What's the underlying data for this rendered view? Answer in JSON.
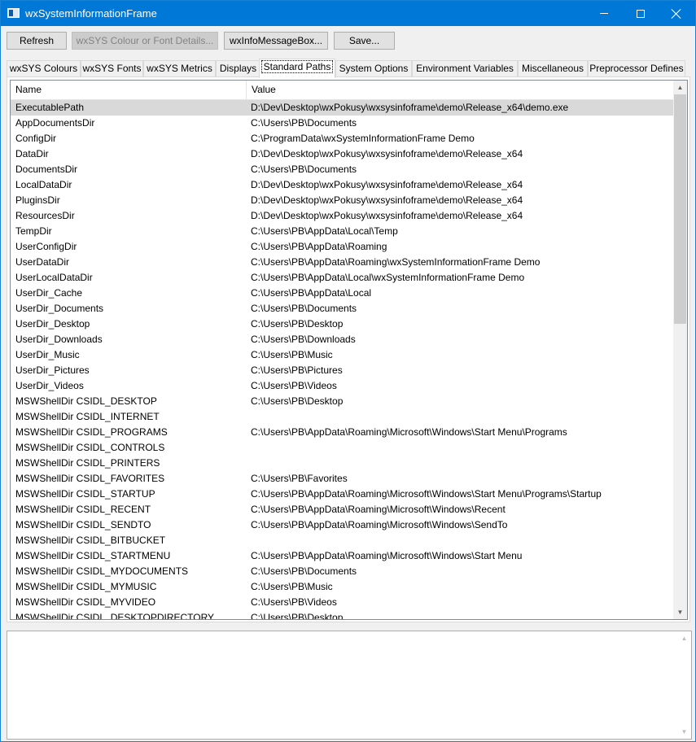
{
  "window": {
    "title": "wxSystemInformationFrame"
  },
  "toolbar": {
    "refresh_label": "Refresh",
    "colour_details_label": "wxSYS Colour or Font Details...",
    "infobox_label": "wxInfoMessageBox...",
    "save_label": "Save..."
  },
  "tabs": [
    {
      "label": "wxSYS Colours"
    },
    {
      "label": "wxSYS Fonts"
    },
    {
      "label": "wxSYS Metrics"
    },
    {
      "label": "Displays"
    },
    {
      "label": "Standard Paths"
    },
    {
      "label": "System Options"
    },
    {
      "label": "Environment Variables"
    },
    {
      "label": "Miscellaneous"
    },
    {
      "label": "Preprocessor Defines"
    }
  ],
  "list": {
    "columns": {
      "name": "Name",
      "value": "Value"
    },
    "rows": [
      {
        "name": "ExecutablePath",
        "value": "D:\\Dev\\Desktop\\wxPokusy\\wxsysinfoframe\\demo\\Release_x64\\demo.exe"
      },
      {
        "name": "AppDocumentsDir",
        "value": "C:\\Users\\PB\\Documents"
      },
      {
        "name": "ConfigDir",
        "value": "C:\\ProgramData\\wxSystemInformationFrame Demo"
      },
      {
        "name": "DataDir",
        "value": "D:\\Dev\\Desktop\\wxPokusy\\wxsysinfoframe\\demo\\Release_x64"
      },
      {
        "name": "DocumentsDir",
        "value": "C:\\Users\\PB\\Documents"
      },
      {
        "name": "LocalDataDir",
        "value": "D:\\Dev\\Desktop\\wxPokusy\\wxsysinfoframe\\demo\\Release_x64"
      },
      {
        "name": "PluginsDir",
        "value": "D:\\Dev\\Desktop\\wxPokusy\\wxsysinfoframe\\demo\\Release_x64"
      },
      {
        "name": "ResourcesDir",
        "value": "D:\\Dev\\Desktop\\wxPokusy\\wxsysinfoframe\\demo\\Release_x64"
      },
      {
        "name": "TempDir",
        "value": "C:\\Users\\PB\\AppData\\Local\\Temp"
      },
      {
        "name": "UserConfigDir",
        "value": "C:\\Users\\PB\\AppData\\Roaming"
      },
      {
        "name": "UserDataDir",
        "value": "C:\\Users\\PB\\AppData\\Roaming\\wxSystemInformationFrame Demo"
      },
      {
        "name": "UserLocalDataDir",
        "value": "C:\\Users\\PB\\AppData\\Local\\wxSystemInformationFrame Demo"
      },
      {
        "name": "UserDir_Cache",
        "value": "C:\\Users\\PB\\AppData\\Local"
      },
      {
        "name": "UserDir_Documents",
        "value": "C:\\Users\\PB\\Documents"
      },
      {
        "name": "UserDir_Desktop",
        "value": "C:\\Users\\PB\\Desktop"
      },
      {
        "name": "UserDir_Downloads",
        "value": "C:\\Users\\PB\\Downloads"
      },
      {
        "name": "UserDir_Music",
        "value": "C:\\Users\\PB\\Music"
      },
      {
        "name": "UserDir_Pictures",
        "value": "C:\\Users\\PB\\Pictures"
      },
      {
        "name": "UserDir_Videos",
        "value": "C:\\Users\\PB\\Videos"
      },
      {
        "name": "MSWShellDir CSIDL_DESKTOP",
        "value": "C:\\Users\\PB\\Desktop"
      },
      {
        "name": "MSWShellDir CSIDL_INTERNET",
        "value": ""
      },
      {
        "name": "MSWShellDir CSIDL_PROGRAMS",
        "value": "C:\\Users\\PB\\AppData\\Roaming\\Microsoft\\Windows\\Start Menu\\Programs"
      },
      {
        "name": "MSWShellDir CSIDL_CONTROLS",
        "value": ""
      },
      {
        "name": "MSWShellDir CSIDL_PRINTERS",
        "value": ""
      },
      {
        "name": "MSWShellDir CSIDL_FAVORITES",
        "value": "C:\\Users\\PB\\Favorites"
      },
      {
        "name": "MSWShellDir CSIDL_STARTUP",
        "value": "C:\\Users\\PB\\AppData\\Roaming\\Microsoft\\Windows\\Start Menu\\Programs\\Startup"
      },
      {
        "name": "MSWShellDir CSIDL_RECENT",
        "value": "C:\\Users\\PB\\AppData\\Roaming\\Microsoft\\Windows\\Recent"
      },
      {
        "name": "MSWShellDir CSIDL_SENDTO",
        "value": "C:\\Users\\PB\\AppData\\Roaming\\Microsoft\\Windows\\SendTo"
      },
      {
        "name": "MSWShellDir CSIDL_BITBUCKET",
        "value": ""
      },
      {
        "name": "MSWShellDir CSIDL_STARTMENU",
        "value": "C:\\Users\\PB\\AppData\\Roaming\\Microsoft\\Windows\\Start Menu"
      },
      {
        "name": "MSWShellDir CSIDL_MYDOCUMENTS",
        "value": "C:\\Users\\PB\\Documents"
      },
      {
        "name": "MSWShellDir CSIDL_MYMUSIC",
        "value": "C:\\Users\\PB\\Music"
      },
      {
        "name": "MSWShellDir CSIDL_MYVIDEO",
        "value": "C:\\Users\\PB\\Videos"
      },
      {
        "name": "MSWShellDir CSIDL_DESKTOPDIRECTORY",
        "value": "C:\\Users\\PB\\Desktop"
      }
    ]
  },
  "log": {
    "text": ""
  },
  "icons": {
    "app": "window-app-icon",
    "minimize": "minimize-icon",
    "maximize": "maximize-icon",
    "close": "close-icon",
    "scroll_up": "chevron-up-icon",
    "scroll_down": "chevron-down-icon"
  },
  "colors": {
    "titlebar": "#0078d7",
    "selected_row": "#d9d9d9",
    "scroll_thumb": "#cdcdcd"
  }
}
